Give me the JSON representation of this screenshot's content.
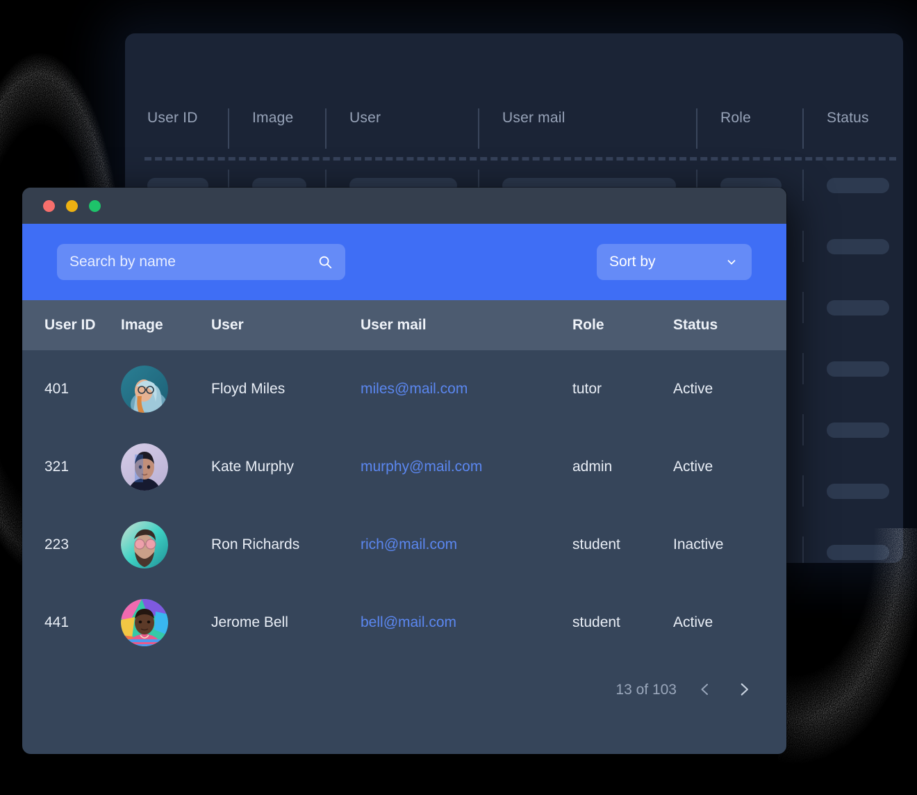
{
  "ghost_panel": {
    "columns": [
      "User ID",
      "Image",
      "User",
      "User mail",
      "Role",
      "Status"
    ]
  },
  "window": {
    "traffic_lights": [
      "close-red",
      "minimize-yellow",
      "maximize-green"
    ]
  },
  "toolbar": {
    "search_placeholder": "Search by name",
    "search_value": "",
    "search_icon": "search-icon",
    "sort_label": "Sort by",
    "sort_icon": "chevron-down-icon"
  },
  "table": {
    "columns": [
      "User ID",
      "Image",
      "User",
      "User mail",
      "Role",
      "Status"
    ],
    "rows": [
      {
        "user_id": "401",
        "image_alt": "avatar-floyd-miles",
        "user": "Floyd Miles",
        "mail": "miles@mail.com",
        "role": "tutor",
        "status": "Active",
        "status_type": "active"
      },
      {
        "user_id": "321",
        "image_alt": "avatar-kate-murphy",
        "user": "Kate Murphy",
        "mail": "murphy@mail.com",
        "role": "admin",
        "status": "Active",
        "status_type": "active"
      },
      {
        "user_id": "223",
        "image_alt": "avatar-ron-richards",
        "user": "Ron Richards",
        "mail": "rich@mail.com",
        "role": "student",
        "status": "Inactive",
        "status_type": "inactive"
      },
      {
        "user_id": "441",
        "image_alt": "avatar-jerome-bell",
        "user": "Jerome Bell",
        "mail": "bell@mail.com",
        "role": "student",
        "status": "Active",
        "status_type": "active"
      }
    ]
  },
  "pagination": {
    "count_label": "13 of 103",
    "prev_icon": "chevron-left-icon",
    "next_icon": "chevron-right-icon"
  },
  "colors": {
    "page_background": "#000000",
    "ghost_panel": "#1b2436",
    "window_body": "#36455a",
    "titlebar": "#353f4e",
    "toolbar_accent": "#3f6ef5",
    "table_header": "#4c5b70",
    "link": "#5b87f0",
    "status_active": "#23d566",
    "status_inactive": "#f2554b",
    "muted_text": "#9aa7bb"
  }
}
